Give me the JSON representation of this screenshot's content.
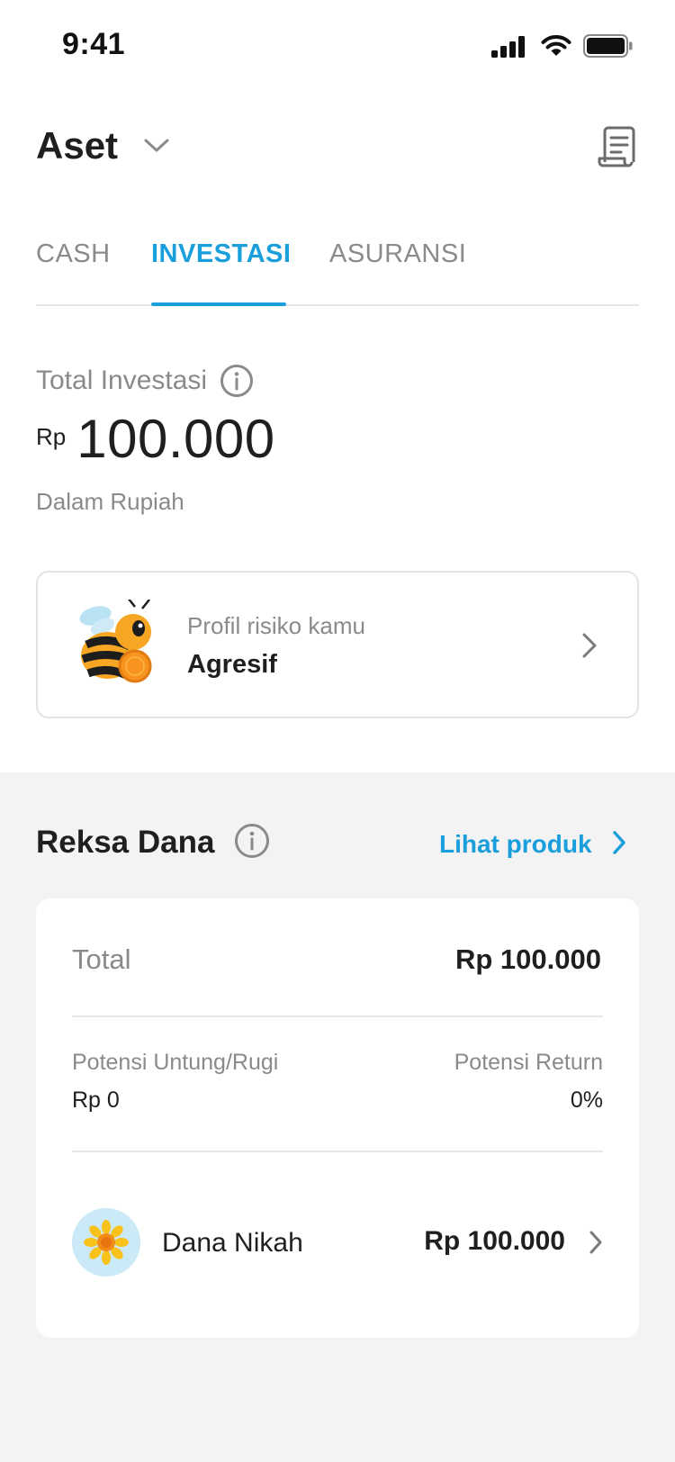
{
  "status_bar": {
    "time": "9:41",
    "icons": [
      "signal-icon",
      "wifi-icon",
      "battery-icon"
    ]
  },
  "header": {
    "title": "Aset",
    "dropdown_icon": "chevron-down-icon",
    "action_icon": "document-icon"
  },
  "tabs": [
    {
      "label": "CASH",
      "active": false
    },
    {
      "label": "INVESTASI",
      "active": true
    },
    {
      "label": "ASURANSI",
      "active": false
    }
  ],
  "total": {
    "label": "Total Investasi",
    "currency": "Rp",
    "amount": "100.000",
    "subtitle": "Dalam Rupiah"
  },
  "risk_profile": {
    "label": "Profil risiko kamu",
    "value": "Agresif",
    "mascot_icon": "bee-mascot-icon"
  },
  "reksa_dana": {
    "title": "Reksa Dana",
    "see_products": "Lihat produk",
    "total_label": "Total",
    "total_value": "Rp 100.000",
    "profit_loss_label": "Potensi Untung/Rugi",
    "profit_loss_value": "Rp 0",
    "return_label": "Potensi Return",
    "return_value": "0%",
    "funds": [
      {
        "name": "Dana Nikah",
        "value": "Rp 100.000",
        "icon": "sunflower-icon"
      }
    ]
  },
  "colors": {
    "accent": "#1a9fdc",
    "text_primary": "#1f1f1f",
    "text_secondary": "#8a8a8a",
    "section_background": "#f3f3f3"
  }
}
